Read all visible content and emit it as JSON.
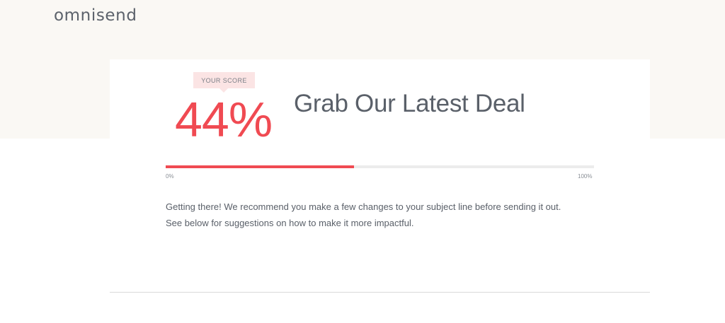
{
  "brand": {
    "logo_text": "omnisend"
  },
  "score": {
    "badge_label": "YOUR SCORE",
    "value_text": "44%",
    "value": 44,
    "accent_color": "#f04a52"
  },
  "subject": {
    "text": "Grab Our Latest Deal"
  },
  "progress": {
    "min_label": "0%",
    "max_label": "100%",
    "fill_fraction": 0.44
  },
  "feedback": {
    "line1": "Getting there! We recommend you make a few changes to your subject line before sending it out.",
    "line2": "See below for suggestions on how to make it more impactful."
  }
}
